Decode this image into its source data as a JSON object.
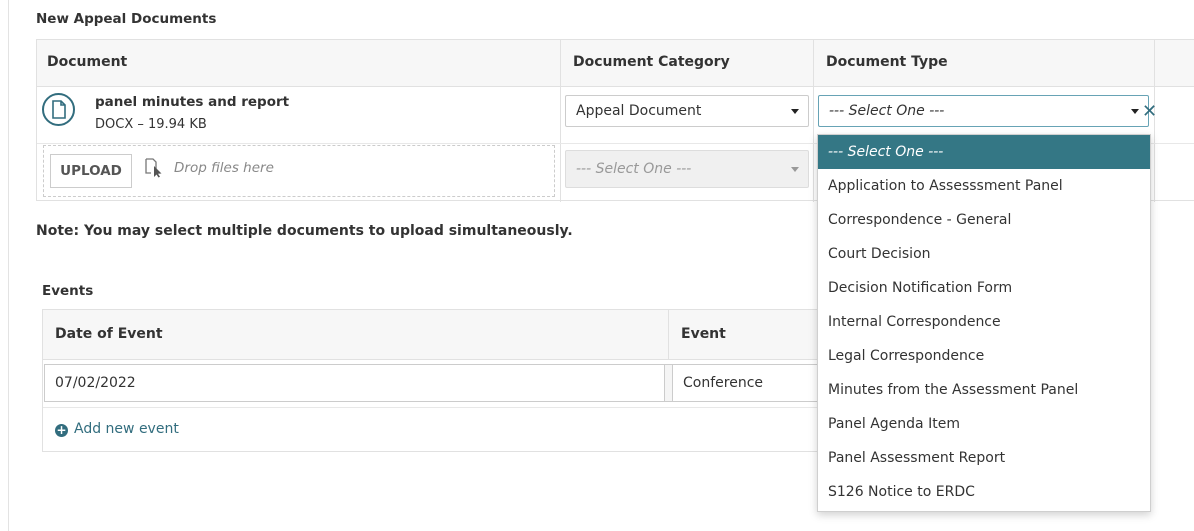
{
  "documents": {
    "section_title": "New Appeal Documents",
    "columns": [
      "Document",
      "Document Category",
      "Document Type"
    ],
    "file": {
      "name": "panel minutes and report",
      "meta": "DOCX – 19.94 KB"
    },
    "category_value": "Appeal Document",
    "type_placeholder": "--- Select One ---",
    "upload_label": "UPLOAD",
    "drop_text": "Drop files here",
    "new_category_placeholder": "--- Select One ---"
  },
  "note": "Note: You may select multiple documents to upload simultaneously.",
  "events": {
    "section_title": "Events",
    "columns": [
      "Date of Event",
      "Event"
    ],
    "rows": [
      {
        "date": "07/02/2022",
        "event": "Conference"
      }
    ],
    "add_label": "Add new event"
  },
  "dropdown": {
    "options": [
      "--- Select One ---",
      "Application to Assesssment Panel",
      "Correspondence - General",
      "Court Decision",
      "Decision Notification Form",
      "Internal Correspondence",
      "Legal Correspondence",
      "Minutes from the Assessment Panel",
      "Panel Agenda Item",
      "Panel Assessment Report",
      "S126 Notice to ERDC"
    ],
    "selected_index": 0
  },
  "colors": {
    "accent": "#326d7e",
    "selected_bg": "#347785"
  },
  "icons": {
    "file": "file-icon",
    "remove": "close-icon",
    "drop": "drop-cursor-icon",
    "calendar": "calendar-icon",
    "add": "plus-circle-icon"
  }
}
